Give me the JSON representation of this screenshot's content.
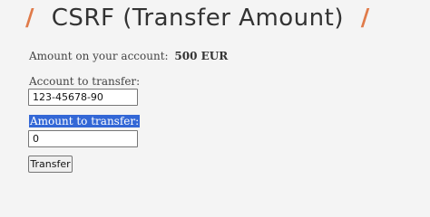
{
  "page": {
    "title": "CSRF (Transfer Amount)",
    "title_decoration": "/",
    "accent_color": "#e07b4a"
  },
  "balance": {
    "label": "Amount on your account:",
    "value": "500 EUR"
  },
  "form": {
    "account_label": "Account to transfer:",
    "account_value": "123-45678-90",
    "amount_label": "Amount to transfer:",
    "amount_value": "0",
    "amount_label_highlight_color": "#3367d6",
    "submit_label": "Transfer"
  }
}
